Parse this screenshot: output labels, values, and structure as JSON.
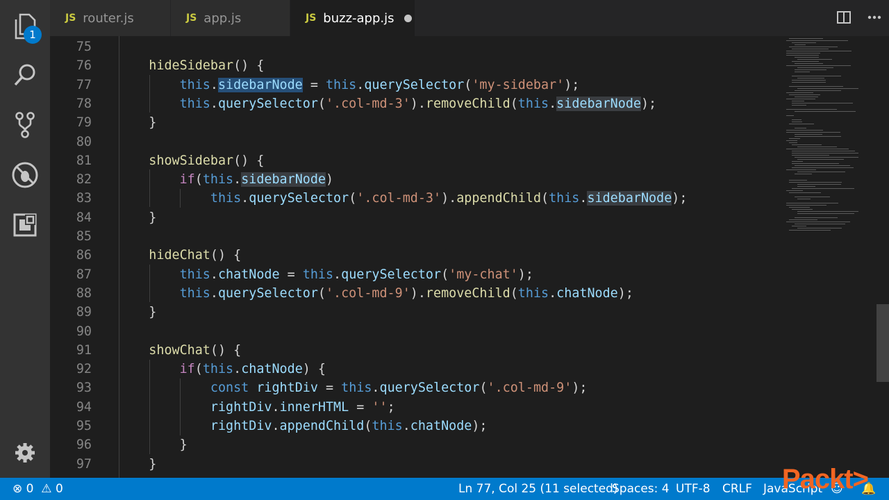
{
  "activity_bar": {
    "items": [
      {
        "name": "explorer-icon",
        "badge": "1"
      },
      {
        "name": "search-icon"
      },
      {
        "name": "source-control-icon"
      },
      {
        "name": "debug-icon"
      },
      {
        "name": "extensions-icon"
      }
    ],
    "bottom": {
      "name": "settings-gear-icon"
    }
  },
  "tabs": [
    {
      "icon": "JS",
      "label": "router.js",
      "active": false
    },
    {
      "icon": "JS",
      "label": "app.js",
      "active": false
    },
    {
      "icon": "JS",
      "label": "buzz-app.js",
      "active": true,
      "modified": true
    }
  ],
  "editor": {
    "lines": [
      {
        "n": "75",
        "code": ""
      },
      {
        "n": "76",
        "code": "    hideSidebar() {"
      },
      {
        "n": "77",
        "code": "        this.sidebarNode = this.querySelector('my-sidebar');"
      },
      {
        "n": "78",
        "code": "        this.querySelector('.col-md-3').removeChild(this.sidebarNode);"
      },
      {
        "n": "79",
        "code": "    }"
      },
      {
        "n": "80",
        "code": ""
      },
      {
        "n": "81",
        "code": "    showSidebar() {"
      },
      {
        "n": "82",
        "code": "        if(this.sidebarNode)"
      },
      {
        "n": "83",
        "code": "            this.querySelector('.col-md-3').appendChild(this.sidebarNode);"
      },
      {
        "n": "84",
        "code": "    }"
      },
      {
        "n": "85",
        "code": ""
      },
      {
        "n": "86",
        "code": "    hideChat() {"
      },
      {
        "n": "87",
        "code": "        this.chatNode = this.querySelector('my-chat');"
      },
      {
        "n": "88",
        "code": "        this.querySelector('.col-md-9').removeChild(this.chatNode);"
      },
      {
        "n": "89",
        "code": "    }"
      },
      {
        "n": "90",
        "code": ""
      },
      {
        "n": "91",
        "code": "    showChat() {"
      },
      {
        "n": "92",
        "code": "        if(this.chatNode) {"
      },
      {
        "n": "93",
        "code": "            const rightDiv = this.querySelector('.col-md-9');"
      },
      {
        "n": "94",
        "code": "            rightDiv.innerHTML = '';"
      },
      {
        "n": "95",
        "code": "            rightDiv.appendChild(this.chatNode);"
      },
      {
        "n": "96",
        "code": "        }"
      },
      {
        "n": "97",
        "code": "    }"
      }
    ]
  },
  "status_bar": {
    "errors": "0",
    "warnings": "0",
    "cursor": "Ln 77, Col 25 (11 selected)",
    "spaces": "Spaces: 4",
    "encoding": "UTF-8",
    "eol": "CRLF",
    "language": "JavaScript"
  },
  "watermark": "Packt>",
  "colors": {
    "status_bar": "#007acc",
    "keyword": "#569cd6",
    "function": "#dcdcaa",
    "property": "#9cdcfe",
    "string": "#ce9178",
    "control": "#c586c0"
  }
}
